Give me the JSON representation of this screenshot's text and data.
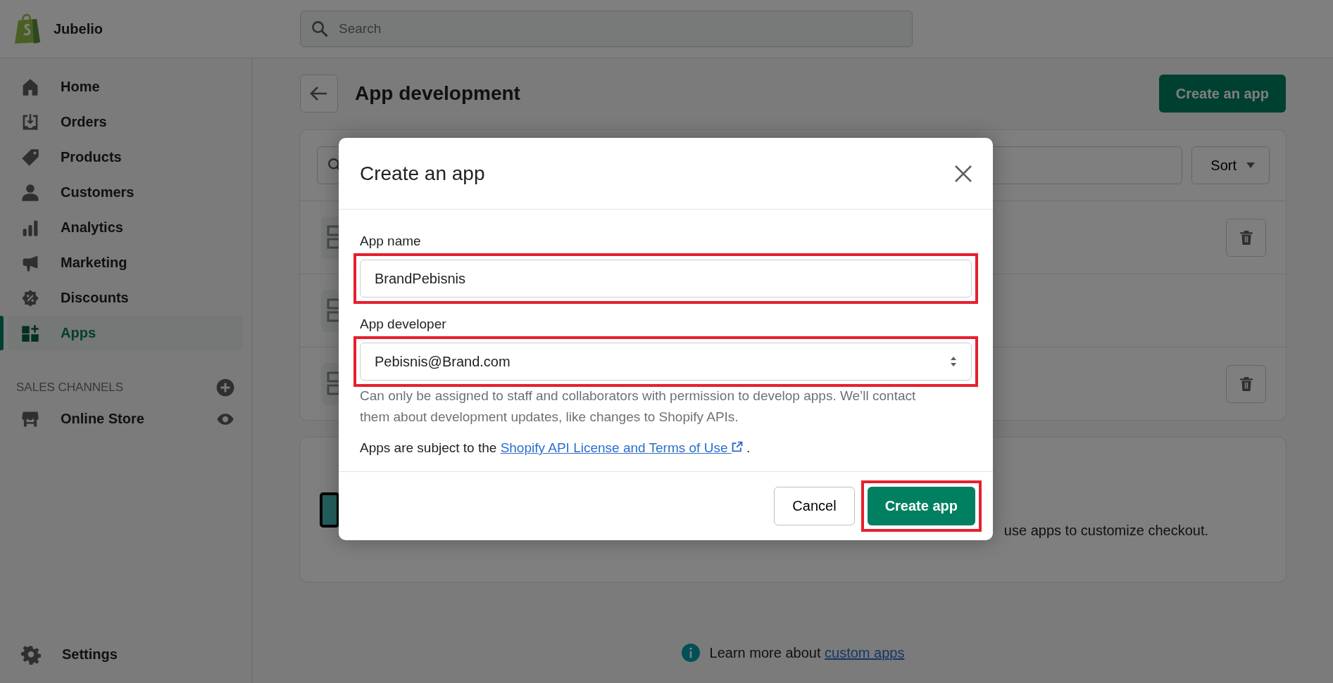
{
  "store": {
    "name": "Jubelio"
  },
  "search": {
    "placeholder": "Search"
  },
  "sidebar": {
    "items": [
      {
        "label": "Home",
        "kind": "home",
        "selected": false
      },
      {
        "label": "Orders",
        "kind": "orders",
        "selected": false
      },
      {
        "label": "Products",
        "kind": "products",
        "selected": false
      },
      {
        "label": "Customers",
        "kind": "customers",
        "selected": false
      },
      {
        "label": "Analytics",
        "kind": "analytics",
        "selected": false
      },
      {
        "label": "Marketing",
        "kind": "marketing",
        "selected": false
      },
      {
        "label": "Discounts",
        "kind": "discounts",
        "selected": false
      },
      {
        "label": "Apps",
        "kind": "apps",
        "selected": true
      }
    ],
    "sales_channels": {
      "heading": "SALES CHANNELS",
      "items": [
        {
          "label": "Online Store"
        }
      ]
    },
    "settings": {
      "label": "Settings"
    }
  },
  "page": {
    "title": "App development",
    "primary_action": "Create an app",
    "sort": {
      "label": "Sort"
    },
    "app_rows": [
      {
        "deletable": true
      },
      {
        "deletable": false
      },
      {
        "deletable": true
      }
    ],
    "checkout_card": {
      "text": "use apps to customize checkout."
    },
    "footer": {
      "text": "Learn more about",
      "link": "custom apps"
    }
  },
  "modal": {
    "title": "Create an app",
    "fields": [
      {
        "kind": "text",
        "label": "App name",
        "value": "BrandPebisnis",
        "highlighted": true
      },
      {
        "kind": "select",
        "label": "App developer",
        "value": "Pebisnis@Brand.com",
        "help": "Can only be assigned to staff and collaborators with permission to develop apps. We’ll contact them about development updates, like changes to Shopify APIs.",
        "highlighted": true
      }
    ],
    "terms": {
      "text": "Apps are subject to the",
      "link": "Shopify API License and Terms of Use",
      "after": "."
    },
    "buttons": [
      {
        "label": "Cancel",
        "kind": "secondary",
        "highlighted": false
      },
      {
        "label": "Create app",
        "kind": "primary",
        "highlighted": true
      }
    ]
  }
}
